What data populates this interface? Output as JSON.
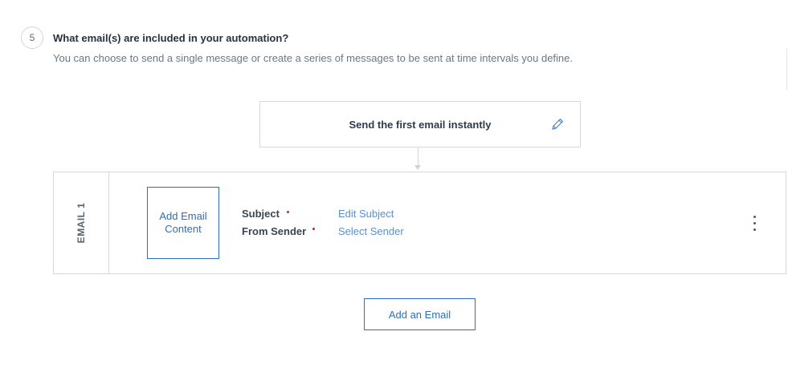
{
  "step": {
    "number": "5",
    "title": "What email(s) are included in your automation?",
    "description": "You can choose to send a single message or create a series of messages to be sent at time intervals you define."
  },
  "trigger": {
    "text": "Send the first email instantly",
    "edit_icon": "pencil-icon"
  },
  "email": {
    "label": "EMAIL 1",
    "add_content_label": "Add Email Content",
    "subject_label": "Subject",
    "subject_value": "Edit Subject",
    "sender_label": "From Sender",
    "sender_value": "Select Sender",
    "menu_icon": "kebab-menu-icon"
  },
  "add_email_label": "Add an Email",
  "colors": {
    "accent": "#2f6fb5",
    "link": "#5b8fcf",
    "required": "#c0262d",
    "border": "#d5d9de"
  }
}
